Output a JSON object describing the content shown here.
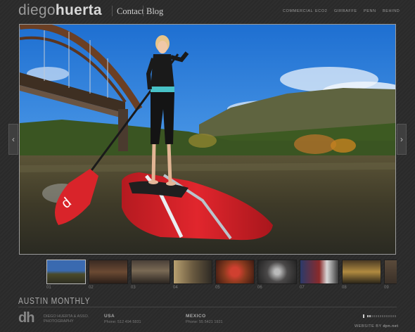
{
  "header": {
    "logo_part1": "diego",
    "logo_part2": "huerta",
    "nav": [
      {
        "label": "Contact"
      },
      {
        "label": "Blog"
      }
    ],
    "subnav": [
      {
        "label": "COMMERCIAL"
      },
      {
        "label": "ECO2"
      },
      {
        "label": "GIRRAFFE"
      },
      {
        "label": "PENN"
      },
      {
        "label": "BEHIND"
      }
    ]
  },
  "gallery": {
    "prev_arrow": "‹",
    "next_arrow": "›",
    "title": "AUSTIN MONTHLY",
    "thumbnails": [
      {
        "num": "01"
      },
      {
        "num": "02"
      },
      {
        "num": "03"
      },
      {
        "num": "04"
      },
      {
        "num": "05"
      },
      {
        "num": "06"
      },
      {
        "num": "07"
      },
      {
        "num": "08"
      },
      {
        "num": "09"
      }
    ]
  },
  "footer": {
    "logo": "dh",
    "company": [
      "DIEGO HUERTA & ASSO.",
      "PHOTOGRAPHY"
    ],
    "usa_title": "USA",
    "usa_phone": "Phone: 512 494 5831",
    "mexico_title": "MEXICO",
    "mexico_phone": "Phone: 55 5421 1921",
    "progress": 0.15,
    "credit": "WEBSITE BY ",
    "credit_brand": "dpn.net"
  },
  "colors": {
    "background": "#2b2b2b",
    "accent_board": "#d8272b"
  }
}
